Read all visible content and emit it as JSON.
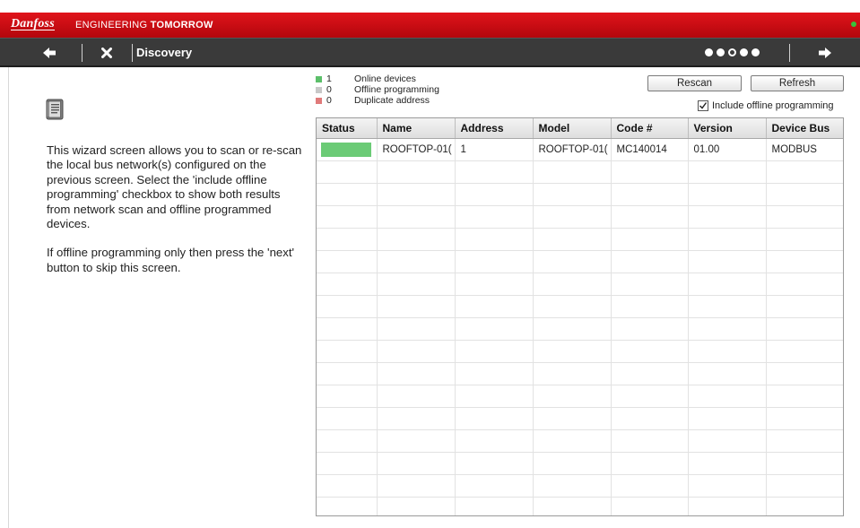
{
  "brand": {
    "logo": "Danfoss",
    "tagline_light": "ENGINEERING ",
    "tagline_bold": "TOMORROW",
    "status_color": "#39c23a"
  },
  "nav": {
    "title": "Discovery",
    "back_icon": "left-arrow-icon",
    "close_icon": "x-icon",
    "next_icon": "right-arrow-icon",
    "steps_total": 5,
    "current_step": 3
  },
  "help": {
    "icon": "wizard-icon",
    "paragraph1": "This wizard screen allows you to scan or re-scan the local bus network(s) configured on the previous screen. Select the 'include offline programming' checkbox to show both results from network scan and offline programmed devices.",
    "paragraph2": "If offline programming only then press the 'next' button to skip this screen."
  },
  "legend": [
    {
      "count": "1",
      "label": "Online devices",
      "color": "#5cbf6a"
    },
    {
      "count": "0",
      "label": "Offline programming",
      "color": "#c8c8c8"
    },
    {
      "count": "0",
      "label": "Duplicate address",
      "color": "#e07a7a"
    }
  ],
  "actions": {
    "rescan": "Rescan",
    "refresh": "Refresh",
    "include_offline_label": "Include offline programming",
    "include_offline_checked": true
  },
  "table": {
    "columns": [
      "Status",
      "Name",
      "Address",
      "Model",
      "Code #",
      "Version",
      "Device Bus"
    ],
    "rows": [
      {
        "status": "online",
        "status_color": "#6bcb76",
        "name": "ROOFTOP-01(",
        "address": "1",
        "model": "ROOFTOP-01(",
        "code": "MC140014",
        "version": "01.00",
        "bus": "MODBUS"
      }
    ]
  }
}
